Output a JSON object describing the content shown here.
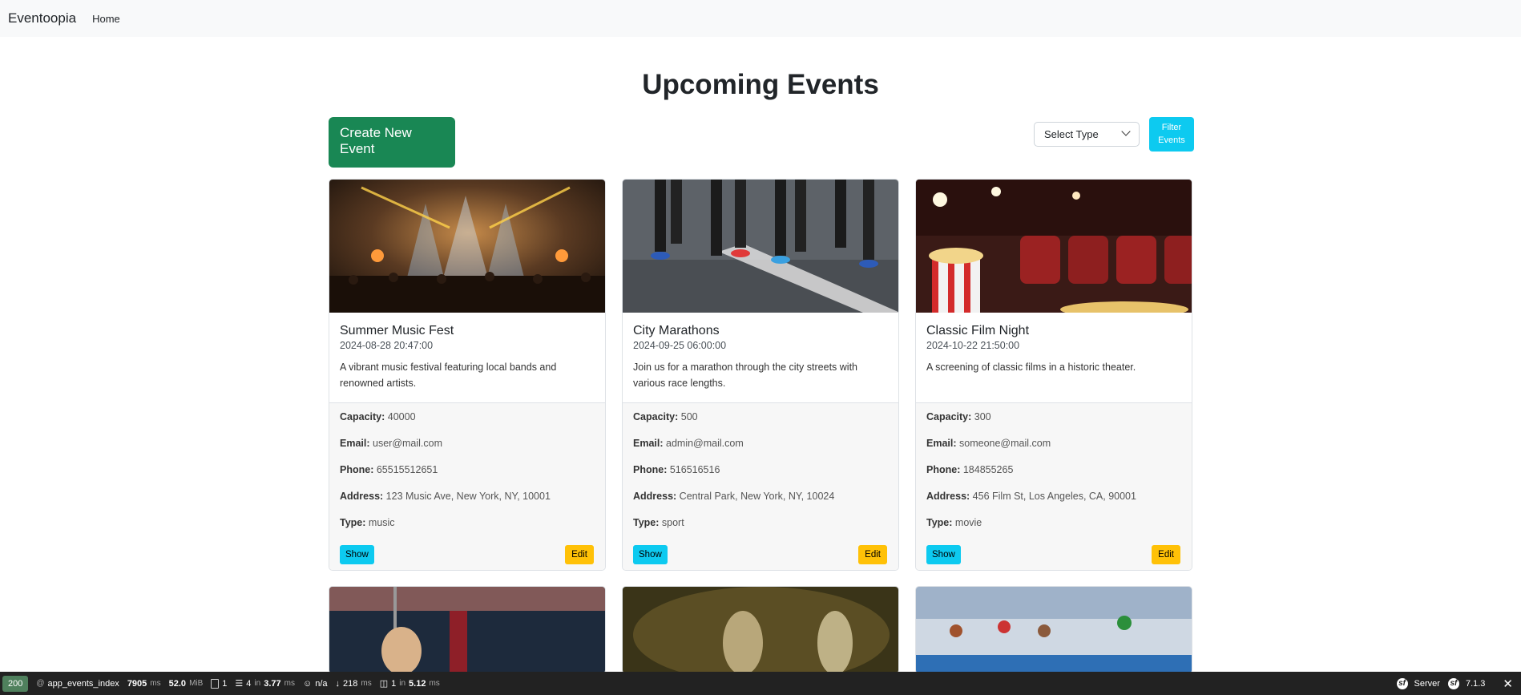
{
  "navbar": {
    "brand": "Eventoopia",
    "home": "Home"
  },
  "page": {
    "title": "Upcoming Events"
  },
  "actions": {
    "create": "Create New Event",
    "select_placeholder": "Select Type",
    "filter": "Filter Events"
  },
  "labels": {
    "capacity": "Capacity:",
    "email": "Email:",
    "phone": "Phone:",
    "address": "Address:",
    "type": "Type:",
    "show": "Show",
    "edit": "Edit"
  },
  "events": [
    {
      "title": "Summer Music Fest",
      "date": "2024-08-28 20:47:00",
      "description": "A vibrant music festival featuring local bands and renowned artists.",
      "capacity": "40000",
      "email": "user@mail.com",
      "phone": "65515512651",
      "address": "123 Music Ave, New York, NY, 10001",
      "type": "music"
    },
    {
      "title": "City Marathons",
      "date": "2024-09-25 06:00:00",
      "description": "Join us for a marathon through the city streets with various race lengths.",
      "capacity": "500",
      "email": "admin@mail.com",
      "phone": "516516516",
      "address": "Central Park, New York, NY, 10024",
      "type": "sport"
    },
    {
      "title": "Classic Film Night",
      "date": "2024-10-22 21:50:00",
      "description": "A screening of classic films in a historic theater.",
      "capacity": "300",
      "email": "someone@mail.com",
      "phone": "184855265",
      "address": "456 Film St, Los Angeles, CA, 90001",
      "type": "movie"
    }
  ],
  "toolbar": {
    "status": "200",
    "route": "app_events_index",
    "time": "7905",
    "time_unit": "ms",
    "memory": "52.0",
    "memory_unit": "MiB",
    "requests": "1",
    "templates": "4",
    "templates_time": "3.77",
    "user": "n/a",
    "cache_time": "218",
    "db_queries": "1",
    "db_time": "5.12",
    "server": "Server",
    "version": "7.1.3"
  }
}
